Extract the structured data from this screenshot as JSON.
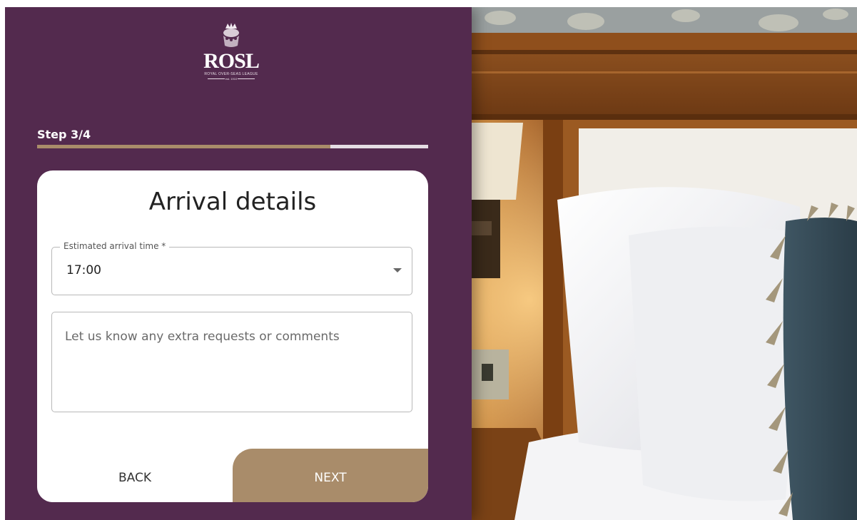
{
  "brand": {
    "logo_text": "ROSL",
    "logo_subtitle": "ROYAL OVER-SEAS LEAGUE",
    "logo_est": "est. 1910"
  },
  "progress": {
    "step_label": "Step 3/4",
    "fill_fraction": 0.75
  },
  "form": {
    "title": "Arrival details",
    "arrival_time": {
      "label": "Estimated arrival time *",
      "value": "17:00"
    },
    "comments": {
      "placeholder": "Let us know any extra requests or comments",
      "value": ""
    },
    "back_label": "BACK",
    "next_label": "NEXT"
  },
  "colors": {
    "panel": "#532a4e",
    "accent": "#a98c6a"
  },
  "photo": {
    "subject": "hotel-bed-photo"
  }
}
